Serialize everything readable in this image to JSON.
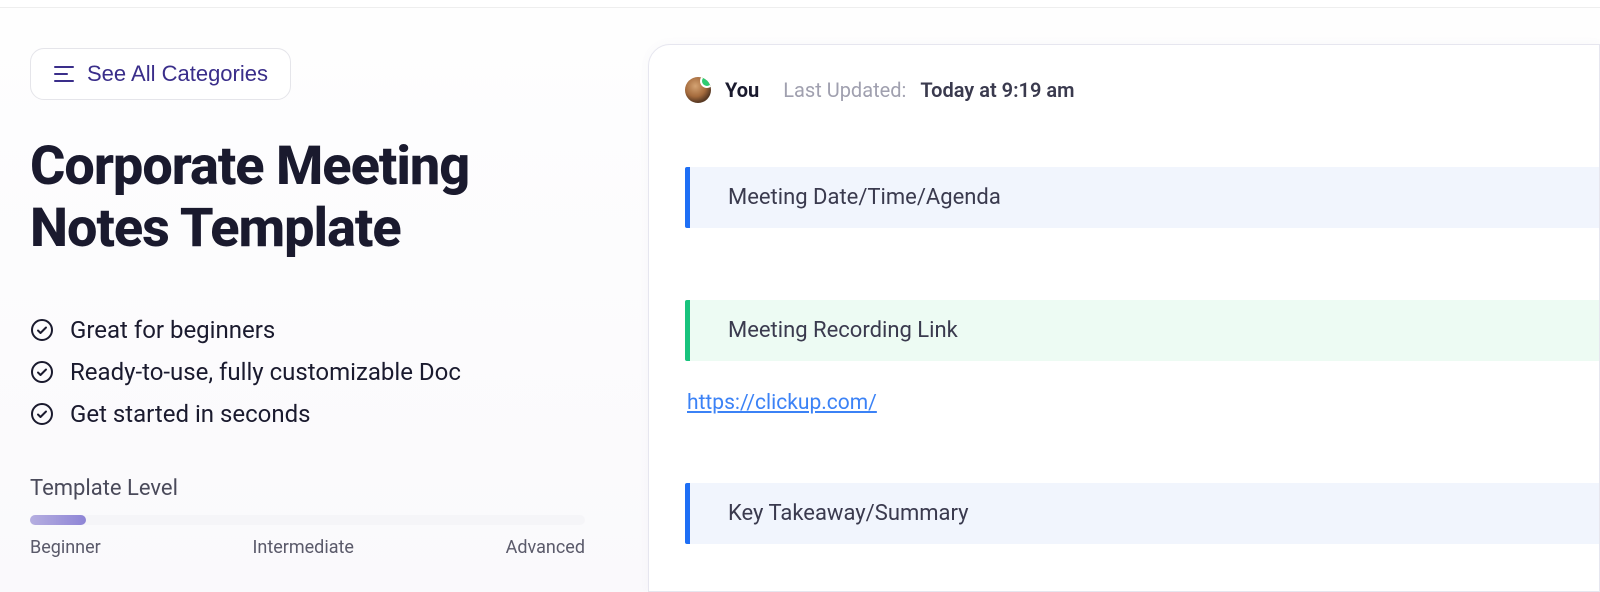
{
  "see_all_label": "See All Categories",
  "title": "Corporate Meeting Notes Template",
  "features": [
    "Great for beginners",
    "Ready-to-use, fully customizable Doc",
    "Get started in seconds"
  ],
  "template_level": {
    "label": "Template Level",
    "ticks": [
      "Beginner",
      "Intermediate",
      "Advanced"
    ]
  },
  "doc": {
    "author": "You",
    "last_updated_label": "Last Updated:",
    "last_updated_value": "Today at 9:19 am",
    "blocks": {
      "agenda": "Meeting Date/Time/Agenda",
      "recording": "Meeting Recording Link",
      "link": "https://clickup.com/",
      "summary": "Key Takeaway/Summary"
    }
  }
}
